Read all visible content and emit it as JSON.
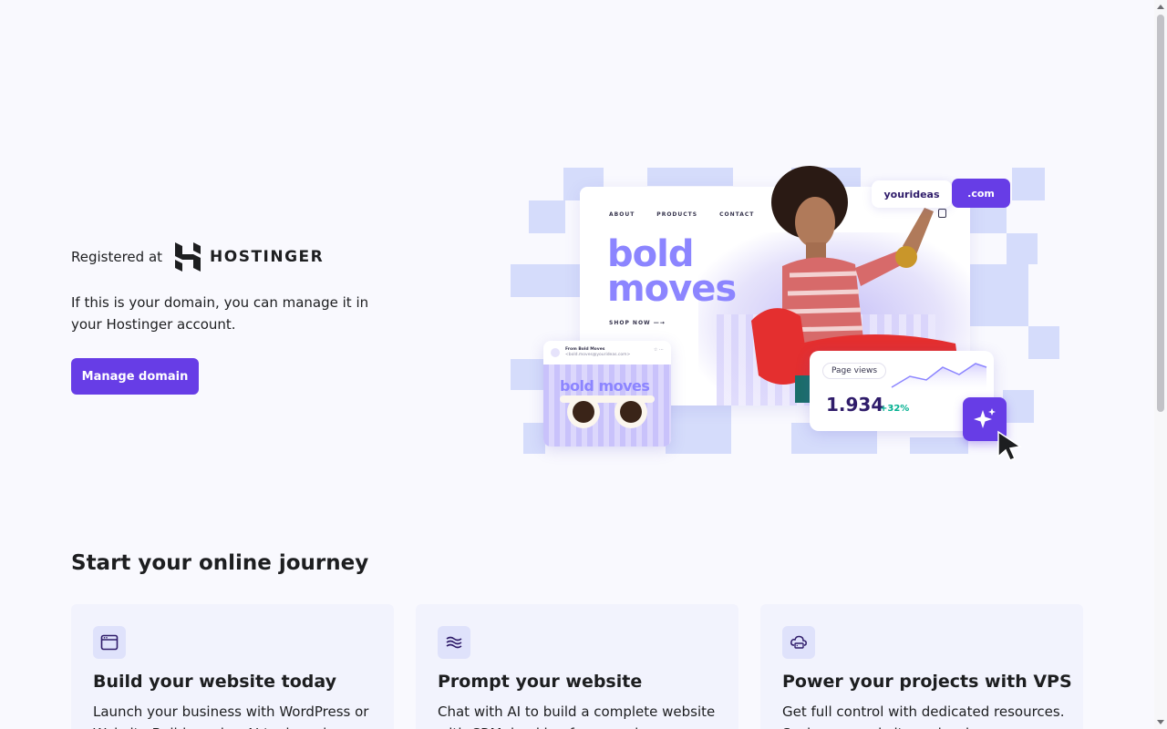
{
  "hero": {
    "registered_label": "Registered at",
    "brand_name": "HOSTINGER",
    "description": "If this is your domain, you can manage it in your Hostinger account.",
    "manage_button": "Manage domain"
  },
  "illustration": {
    "nav": [
      "ABOUT",
      "PRODUCTS",
      "CONTACT"
    ],
    "headline_line1": "bold",
    "headline_line2": "moves",
    "shop_now": "SHOP NOW",
    "domain_name": "yourideas",
    "domain_tld": ".com",
    "email_from": "From Bold Moves",
    "email_address": "<bold.moves@yourideas.com>",
    "email_headline": "bold moves",
    "page_views_label": "Page views",
    "page_views_value": "1.934",
    "page_views_delta": "+32%"
  },
  "journey": {
    "title": "Start your online journey",
    "cards": [
      {
        "icon": "browser-window-icon",
        "title": "Build your website today",
        "text": "Launch your business with WordPress or Website Builder using AI tools and"
      },
      {
        "icon": "ai-waves-icon",
        "title": "Prompt your website",
        "text": "Chat with AI to build a complete website with CRM, booking forms and"
      },
      {
        "icon": "cloud-server-icon",
        "title": "Power your projects with VPS",
        "text": "Get full control with dedicated resources. Scale your website and web apps"
      }
    ]
  },
  "colors": {
    "accent": "#673de6",
    "background": "#f9f9fe",
    "card_background": "#f2f3fd",
    "text": "#1d1e20",
    "positive": "#00b090"
  }
}
